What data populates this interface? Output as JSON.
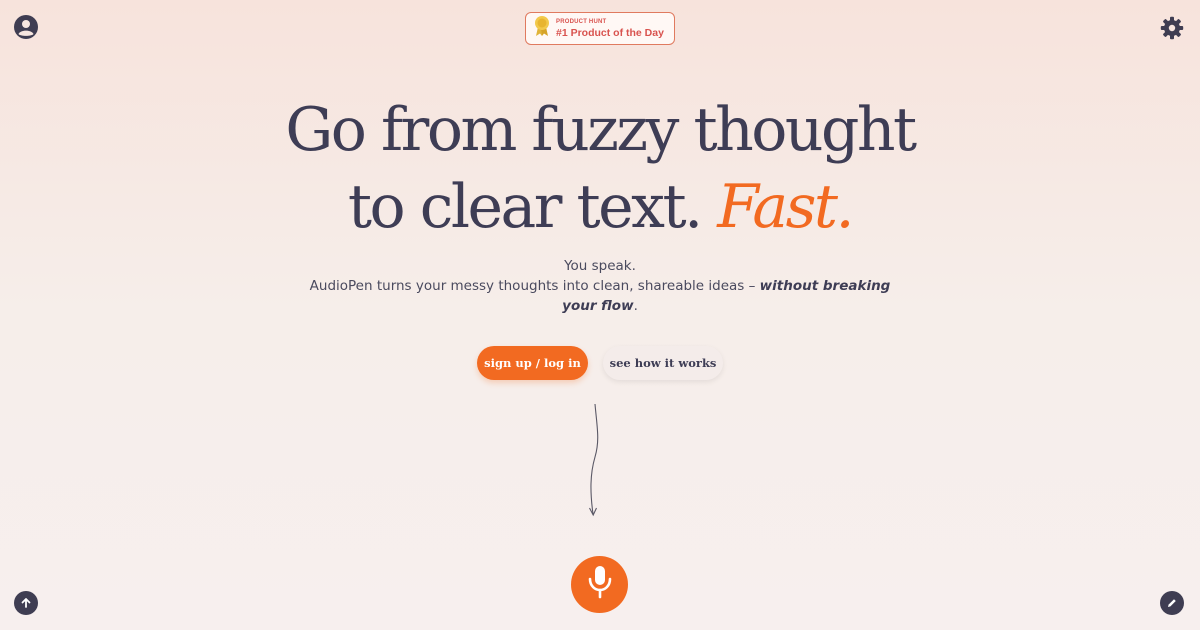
{
  "header": {
    "account_icon": "user-circle-icon",
    "settings_icon": "gear-icon"
  },
  "badge": {
    "kicker": "PRODUCT HUNT",
    "title": "#1 Product of the Day",
    "icon": "medal-icon"
  },
  "hero": {
    "line1": "Go from fuzzy thought",
    "line2": "to clear text.",
    "accent": "Fast."
  },
  "subtitle": {
    "line1": "You speak.",
    "line2": "AudioPen turns your messy thoughts into clean, shareable ideas –",
    "emphasis": "without breaking your flow",
    "end": "."
  },
  "actions": {
    "primary": "sign up / log in",
    "secondary": "see how it works"
  },
  "colors": {
    "accent": "#f26a21",
    "text": "#3e3d55",
    "badge": "#d9534f"
  },
  "footer": {
    "scroll_icon": "arrow-up-icon",
    "edit_icon": "pencil-icon",
    "mic_icon": "microphone-icon"
  }
}
